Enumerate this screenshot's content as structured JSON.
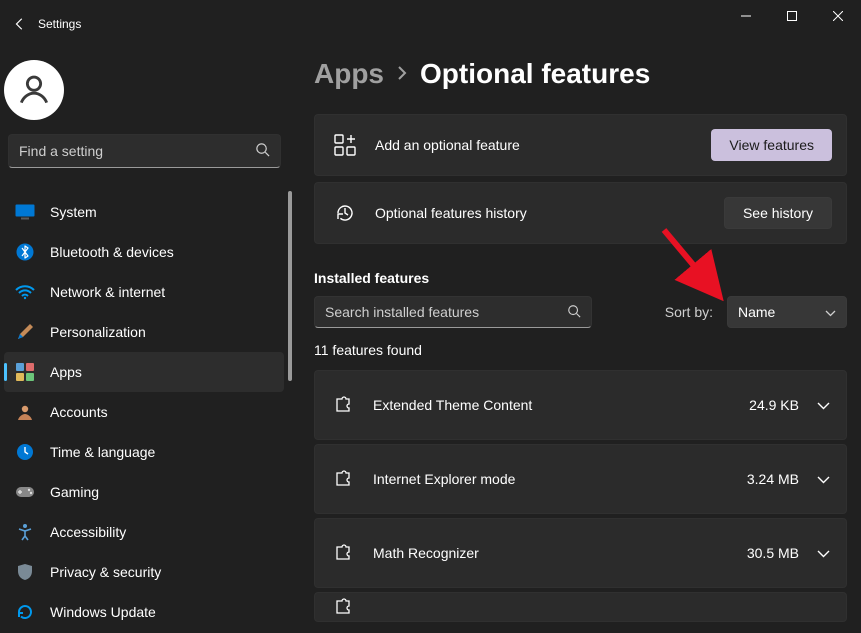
{
  "window": {
    "title": "Settings"
  },
  "search": {
    "placeholder": "Find a setting"
  },
  "sidebar": {
    "items": [
      {
        "label": "System"
      },
      {
        "label": "Bluetooth & devices"
      },
      {
        "label": "Network & internet"
      },
      {
        "label": "Personalization"
      },
      {
        "label": "Apps"
      },
      {
        "label": "Accounts"
      },
      {
        "label": "Time & language"
      },
      {
        "label": "Gaming"
      },
      {
        "label": "Accessibility"
      },
      {
        "label": "Privacy & security"
      },
      {
        "label": "Windows Update"
      }
    ]
  },
  "breadcrumb": {
    "parent": "Apps",
    "current": "Optional features"
  },
  "cards": {
    "add": {
      "label": "Add an optional feature",
      "button": "View features"
    },
    "history": {
      "label": "Optional features history",
      "button": "See history"
    }
  },
  "installed": {
    "title": "Installed features",
    "search_placeholder": "Search installed features",
    "sort_label": "Sort by:",
    "sort_value": "Name",
    "count": "11 features found",
    "features": [
      {
        "name": "Extended Theme Content",
        "size": "24.9 KB"
      },
      {
        "name": "Internet Explorer mode",
        "size": "3.24 MB"
      },
      {
        "name": "Math Recognizer",
        "size": "30.5 MB"
      }
    ]
  }
}
